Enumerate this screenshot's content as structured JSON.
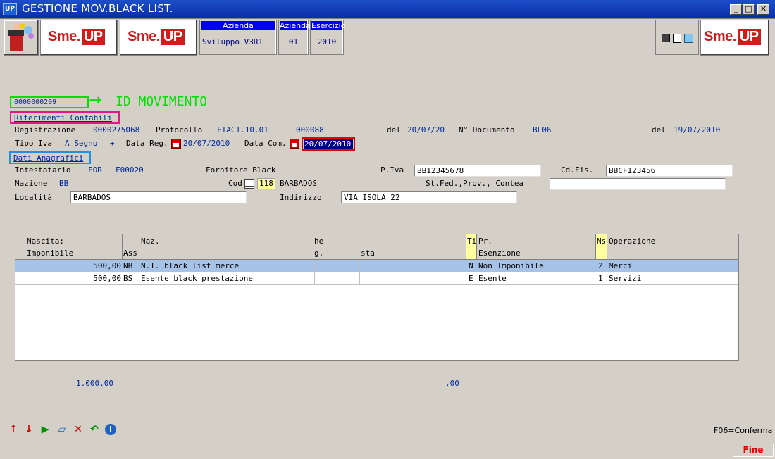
{
  "window": {
    "icon_text": "UP",
    "title": "GESTIONE MOV.BLACK LIST.",
    "min": "_",
    "max": "□",
    "close": "✕"
  },
  "toolbar": {
    "logo_left": "Sme.",
    "logo_up": "UP",
    "azienda_label": "Azienda",
    "azienda_value": "Sviluppo V3R1",
    "azienda_code_label": "Azienda",
    "azienda_code_value": "01",
    "esercizio_label": "Esercizio",
    "esercizio_value": "2010"
  },
  "annotation": {
    "id_value": "0000000209",
    "id_arrow": "→",
    "id_label": "ID MOVIMENTO"
  },
  "section_rif": "Riferimenti Contabili",
  "rif": {
    "registrazione_label": "Registrazione",
    "registrazione_value": "0000275068",
    "protocollo_label": "Protocollo",
    "protocollo_value": "FTAC1.10.01",
    "protocollo_num": "000088",
    "del_label": "del",
    "del_value": "20/07/20",
    "ndoc_label": "N° Documento",
    "ndoc_value": "BL06",
    "del2_label": "del",
    "del2_value": "19/07/2010",
    "tipo_iva_label": "Tipo Iva",
    "tipo_iva_value": "A Segno",
    "tipo_iva_sign": "+",
    "data_reg_label": "Data Reg.",
    "data_reg_value": "20/07/2010",
    "data_com_label": "Data Com.",
    "data_com_value": "20/07/2010"
  },
  "section_anag": "Dati Anagrafici",
  "anag": {
    "intestatario_label": "Intestatario",
    "intestatario_type": "FOR",
    "intestatario_code": "F00020",
    "intestatario_name": "Fornitore Black",
    "piva_label": "P.Iva",
    "piva_value": "BB12345678",
    "cdfis_label": "Cd.Fis.",
    "cdfis_value": "BBCF123456",
    "nazione_label": "Nazione",
    "nazione_value": "BB",
    "cod_label": "Cod",
    "cod_value": "118",
    "cod_desc": "BARBADOS",
    "stfed_label": "St.Fed.,Prov., Contea",
    "stfed_value": "",
    "localita_label": "Località",
    "localita_value": "BARBADOS",
    "indirizzo_label": "Indirizzo",
    "indirizzo_value": "VIA ISOLA 22"
  },
  "grid": {
    "headers": {
      "nascita": "Nascita:",
      "imponibile": "Imponibile",
      "ass": "Ass",
      "naz": "Naz.",
      "col_he": "he",
      "col_g": "g.",
      "col_sta": "sta",
      "ti": "Ti",
      "pr": "Pr.",
      "esenzione": "Esenzione",
      "ns": "Ns",
      "operazione": "Operazione"
    },
    "rows": [
      {
        "imponibile": "500,00",
        "ass": "NB",
        "desc": "N.I. black list merce",
        "ti": "N",
        "esenzione": "Non Imponibile",
        "ns": "2",
        "operazione": "Merci"
      },
      {
        "imponibile": "500,00",
        "ass": "BS",
        "desc": "Esente black prestazione",
        "ti": "E",
        "esenzione": "Esente",
        "ns": "1",
        "operazione": "Servizi"
      }
    ]
  },
  "totals": {
    "imponibile": "1.000,00",
    "imposta": ",00"
  },
  "footer": {
    "f06": "F06=Conferma",
    "fine": "Fine"
  },
  "colors": {
    "selected_row": "#a6c2e6",
    "annotation_green": "#00e000",
    "annotation_magenta": "#e0188c",
    "annotation_blue": "#2090e0",
    "annotation_red": "#e00000"
  }
}
